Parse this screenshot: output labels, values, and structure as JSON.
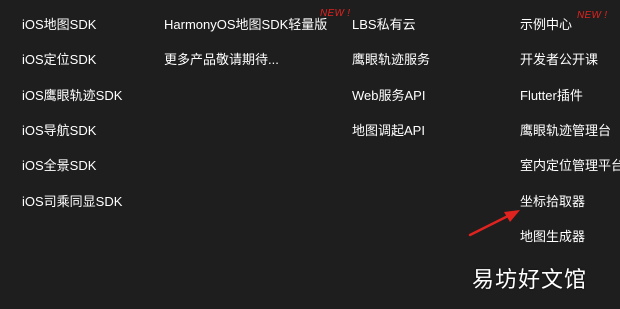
{
  "columns": {
    "col1": [
      "iOS地图SDK",
      "iOS定位SDK",
      "iOS鹰眼轨迹SDK",
      "iOS导航SDK",
      "iOS全景SDK",
      "iOS司乘同显SDK"
    ],
    "col2": [
      "HarmonyOS地图SDK轻量版",
      "更多产品敬请期待..."
    ],
    "col3": [
      "LBS私有云",
      "鹰眼轨迹服务",
      "Web服务API",
      "地图调起API"
    ],
    "col4": [
      "示例中心",
      "开发者公开课",
      "Flutter插件",
      "鹰眼轨迹管理台",
      "室内定位管理平台",
      "坐标拾取器",
      "地图生成器"
    ]
  },
  "badges": {
    "harmonyos_new": "NEW !",
    "examples_new": "NEW !"
  },
  "watermark": "易坊好文馆",
  "colors": {
    "background": "#1e1e1e",
    "text": "#ffffff",
    "badge": "#e0231f",
    "arrow": "#e0231f"
  },
  "icons": {
    "annotation": "red-arrow-icon"
  }
}
